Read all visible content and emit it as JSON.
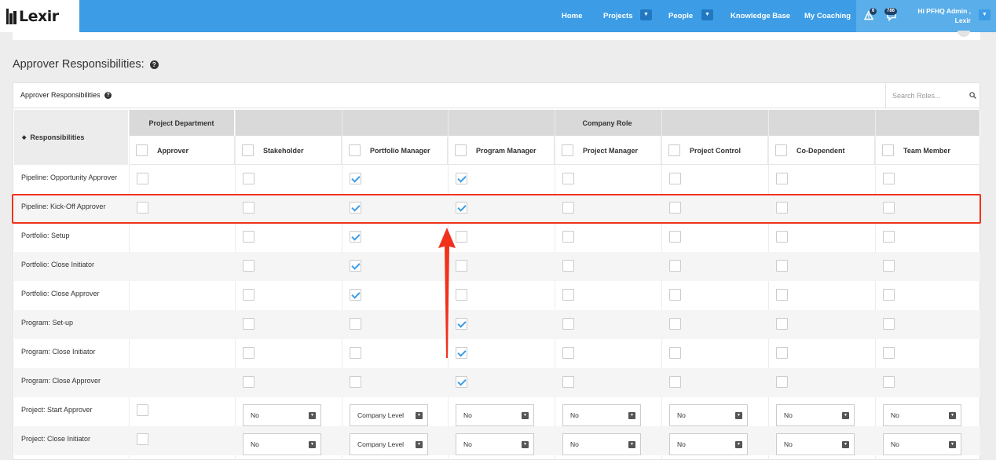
{
  "brand": {
    "name": "Lexir"
  },
  "nav": {
    "home": "Home",
    "projects": "Projects",
    "people": "People",
    "knowledge_base": "Knowledge Base",
    "my_coaching": "My Coaching",
    "notification_count": "6",
    "message_count": "786",
    "greeting": "Hi PFHQ Admin ,",
    "company": "Lexir"
  },
  "page": {
    "title": "Approver Responsibilities:",
    "panel_title": "Approver Responsibilities",
    "search_placeholder": "Search Roles..."
  },
  "table": {
    "groups": {
      "project_department": "Project Department",
      "company_role": "Company Role"
    },
    "responsibilities_header": "Responsibilities",
    "columns": [
      "Approver",
      "Stakeholder",
      "Portfolio Manager",
      "Program Manager",
      "Project Manager",
      "Project Control",
      "Co-Dependent",
      "Team Member"
    ],
    "rows": [
      {
        "label": "Pipeline: Opportunity Approver",
        "checks": [
          false,
          false,
          true,
          true,
          false,
          false,
          false,
          false
        ]
      },
      {
        "label": "Pipeline: Kick-Off Approver",
        "checks": [
          false,
          false,
          true,
          true,
          false,
          false,
          false,
          false
        ]
      },
      {
        "label": "Portfolio: Setup",
        "checks": [
          null,
          false,
          true,
          false,
          false,
          false,
          false,
          false
        ]
      },
      {
        "label": "Portfolio: Close Initiator",
        "checks": [
          null,
          false,
          true,
          false,
          false,
          false,
          false,
          false
        ]
      },
      {
        "label": "Portfolio: Close Approver",
        "checks": [
          null,
          false,
          true,
          false,
          false,
          false,
          false,
          false
        ]
      },
      {
        "label": "Program: Set-up",
        "checks": [
          null,
          false,
          false,
          true,
          false,
          false,
          false,
          false
        ]
      },
      {
        "label": "Program: Close Initiator",
        "checks": [
          null,
          false,
          false,
          true,
          false,
          false,
          false,
          false
        ]
      },
      {
        "label": "Program: Close Approver",
        "checks": [
          null,
          false,
          false,
          true,
          false,
          false,
          false,
          false
        ]
      },
      {
        "label": "Project: Start Approver",
        "checks": [
          false
        ],
        "selects": [
          "No",
          "Company Level",
          "No",
          "No",
          "No",
          "No",
          "No"
        ]
      },
      {
        "label": "Project: Close Initiator",
        "checks": [
          false
        ],
        "selects": [
          "No",
          "Company Level",
          "No",
          "No",
          "No",
          "No",
          "No"
        ]
      }
    ]
  },
  "colors": {
    "nav": "#3c9de6",
    "highlight": "#f0321d",
    "check": "#3c9de6"
  }
}
